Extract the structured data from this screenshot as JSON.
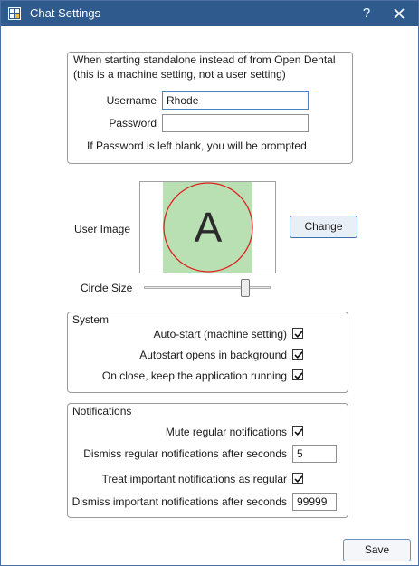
{
  "window": {
    "title": "Chat Settings",
    "help_label": "?"
  },
  "standalone": {
    "header_line1": "When starting standalone instead of from Open Dental",
    "header_line2": "(this is a machine setting, not a user setting)",
    "username_label": "Username",
    "username_value": "Rhode",
    "password_label": "Password",
    "password_value": "",
    "hint": "If Password is left blank, you will be prompted"
  },
  "user_image": {
    "label": "User Image",
    "avatar_letter": "A",
    "avatar_fill": "#b9e0b3",
    "avatar_ring": "#e02020",
    "change_label": "Change"
  },
  "circle_size": {
    "label": "Circle Size",
    "level": 0.82
  },
  "system": {
    "legend": "System",
    "options": [
      {
        "label": "Auto-start (machine setting)",
        "checked": true
      },
      {
        "label": "Autostart opens in background",
        "checked": true
      },
      {
        "label": "On close, keep the application running",
        "checked": true
      }
    ]
  },
  "notifications": {
    "legend": "Notifications",
    "mute_label": "Mute regular notifications",
    "mute_checked": true,
    "dismiss_regular_label": "Dismiss regular notifications after seconds",
    "dismiss_regular_value": "5",
    "treat_important_label": "Treat important notifications as regular",
    "treat_important_checked": true,
    "dismiss_important_label": "Dismiss important notifications after seconds",
    "dismiss_important_value": "99999"
  },
  "footer": {
    "save_label": "Save"
  },
  "colors": {
    "titlebar": "#2e5a8e",
    "accent": "#3b6fb0"
  }
}
